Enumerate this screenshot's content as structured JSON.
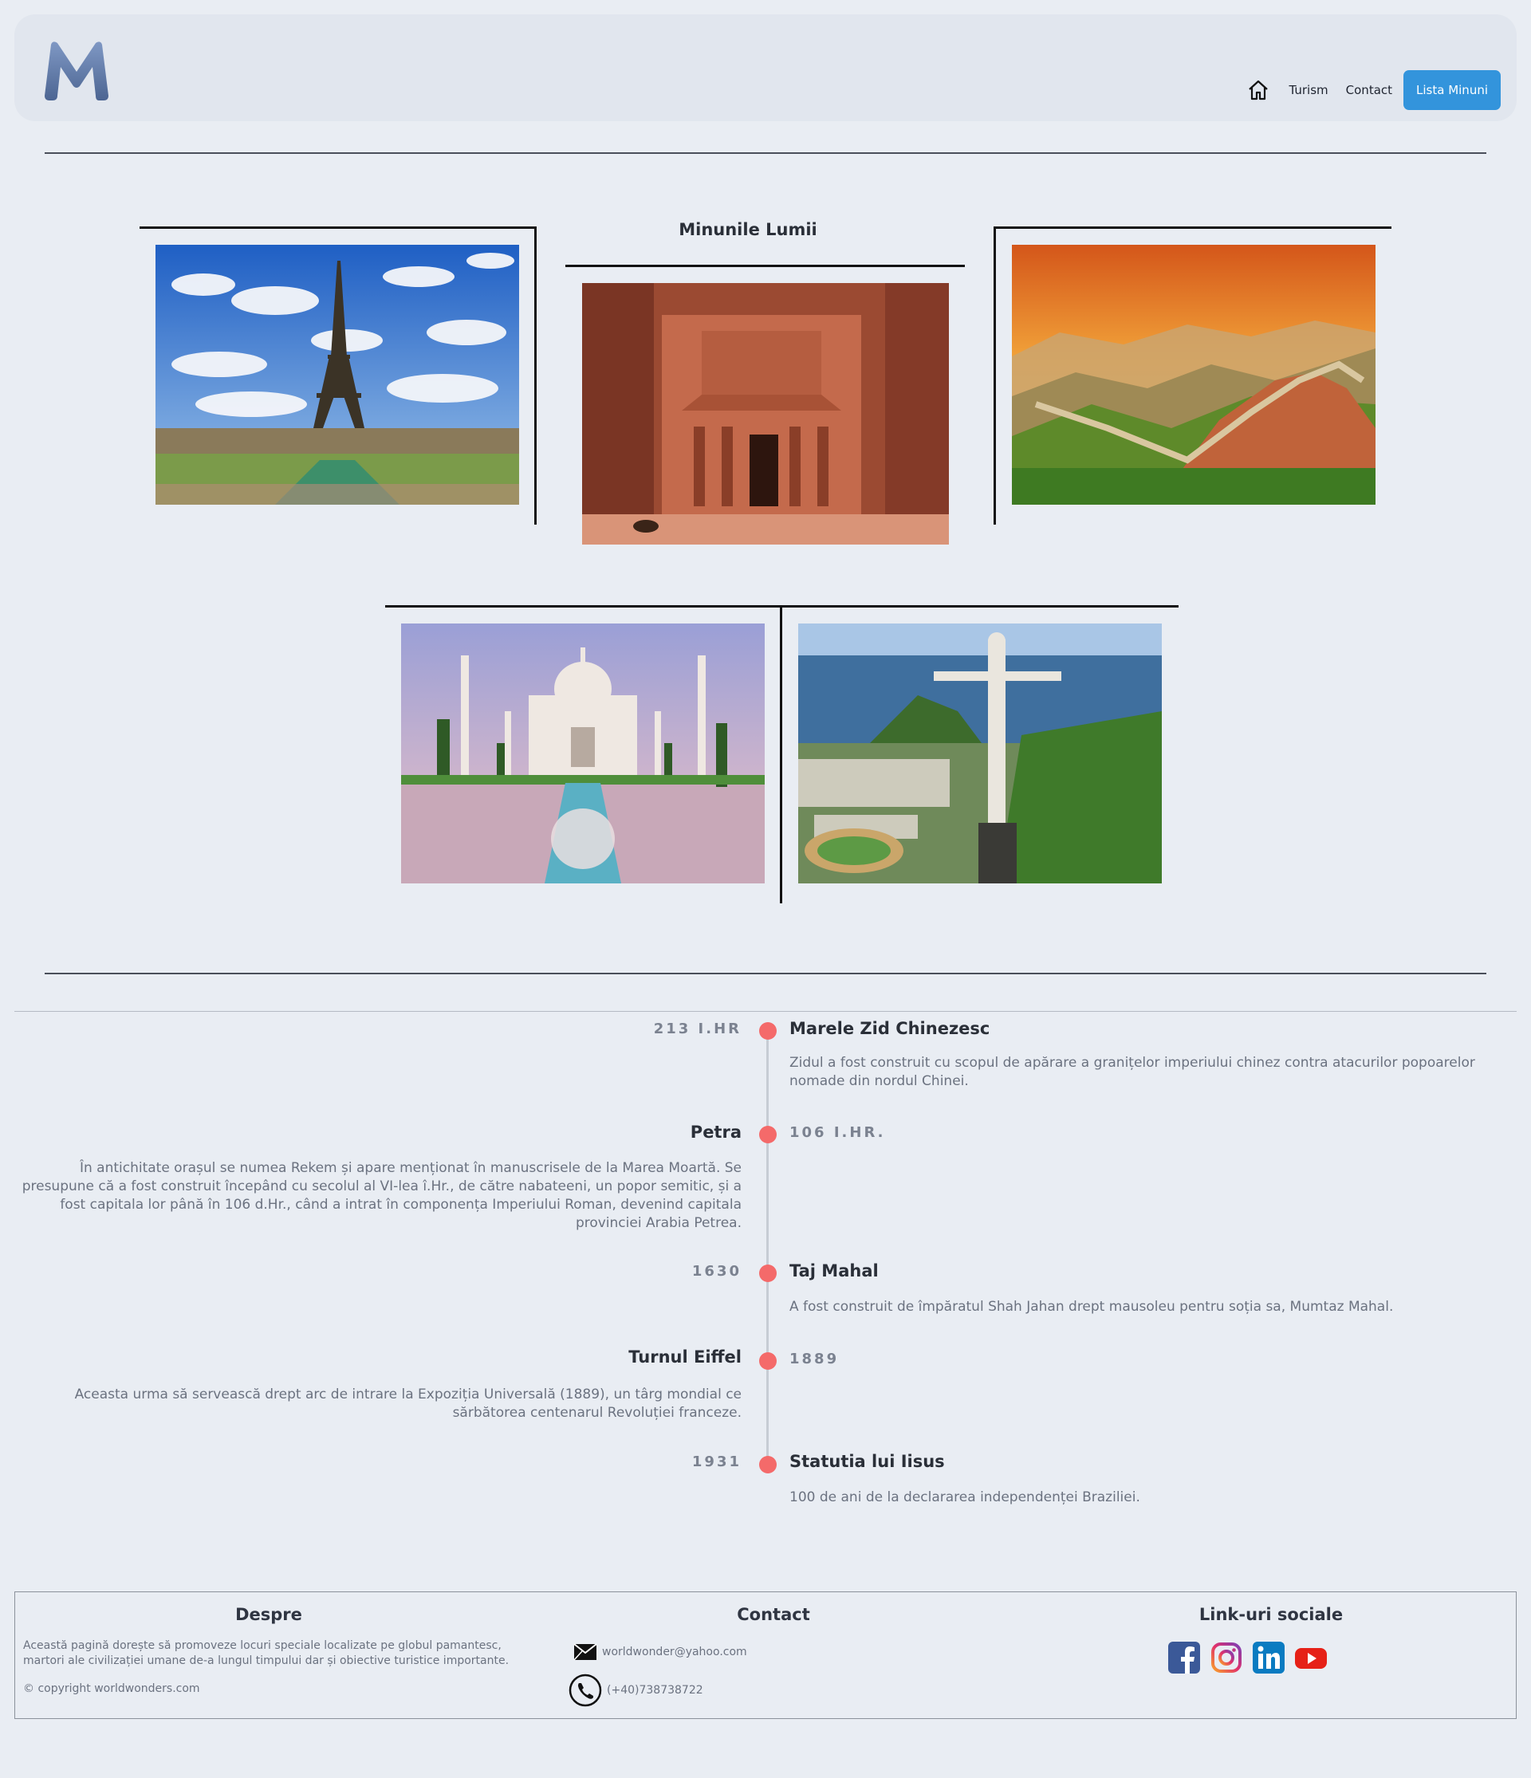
{
  "header": {
    "logo_letter": "M",
    "nav": {
      "home_icon": "home-icon",
      "turism": "Turism",
      "contact": "Contact",
      "lista": "Lista Minuni"
    },
    "accent": "#3394dc"
  },
  "gallery": {
    "title": "Minunile Lumii",
    "photos": [
      {
        "subject": "eiffel-tower-photo"
      },
      {
        "subject": "petra-photo"
      },
      {
        "subject": "great-wall-photo"
      },
      {
        "subject": "taj-mahal-photo"
      },
      {
        "subject": "christ-the-redeemer-photo"
      }
    ]
  },
  "timeline": {
    "dot_color": "#f46a6a",
    "items": [
      {
        "date": "213 I.HR",
        "title": "Marele Zid Chinezesc",
        "text": "Zidul a fost construit cu scopul de apărare a granițelor imperiului chinez contra atacurilor popoarelor nomade din nordul Chinei."
      },
      {
        "date": "106 I.HR.",
        "title": "Petra",
        "text": "În antichitate orașul se numea Rekem și apare menționat în manuscrisele de la Marea Moartă. Se presupune că a fost construit începând cu secolul al VI-lea î.Hr., de către nabateeni, un popor semitic, și a fost capitala lor până în 106 d.Hr., când a intrat în componența Imperiului Roman, devenind capitala provinciei Arabia Petrea."
      },
      {
        "date": "1630",
        "title": "Taj Mahal",
        "text": "A fost construit de împăratul Shah Jahan drept mausoleu pentru soția sa, Mumtaz Mahal."
      },
      {
        "date": "1889",
        "title": "Turnul Eiffel",
        "text": "Aceasta urma să servească drept arc de intrare la Expoziția Universală (1889), un târg mondial ce sărbătorea centenarul Revoluției franceze."
      },
      {
        "date": "1931",
        "title": "Statutia lui Iisus",
        "text": "100 de ani de la declararea independenței Braziliei."
      }
    ]
  },
  "footer": {
    "about": {
      "title": "Despre",
      "text": "Această pagină dorește să promoveze locuri speciale localizate pe globul pamantesc, martori ale civilizației umane de-a lungul timpului dar și obiective turistice importante.",
      "copyright": "© copyright worldwonders.com"
    },
    "contact": {
      "title": "Contact",
      "email": "worldwonder@yahoo.com",
      "phone": "(+40)738738722"
    },
    "social": {
      "title": "Link-uri sociale",
      "icons": [
        "facebook-icon",
        "instagram-icon",
        "linkedin-icon",
        "youtube-icon"
      ]
    }
  }
}
